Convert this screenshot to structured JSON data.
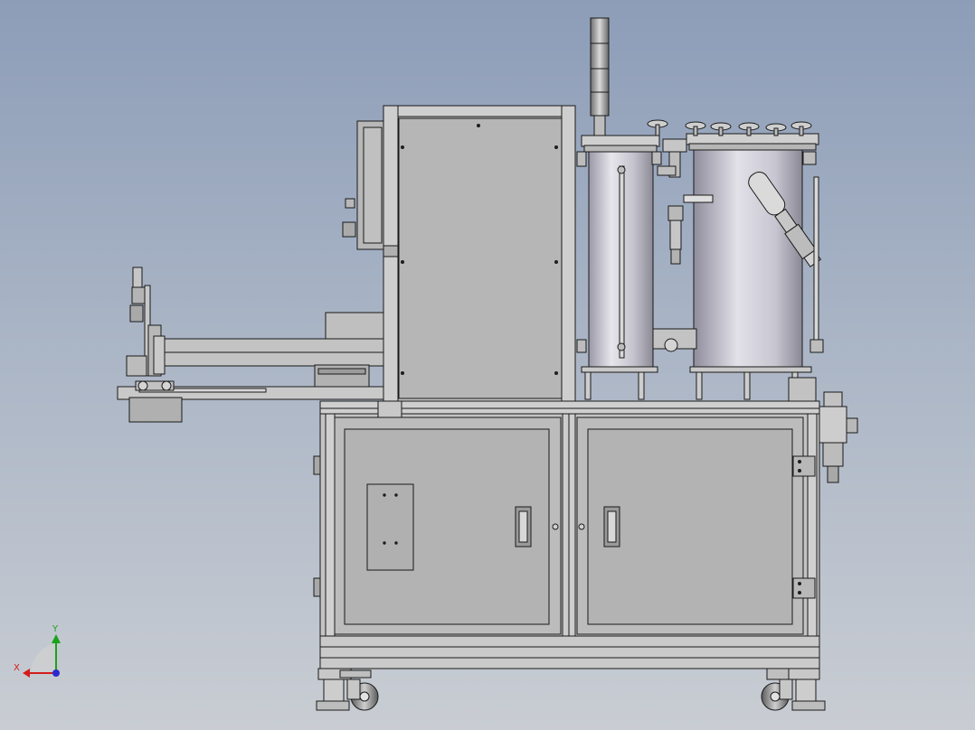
{
  "view": {
    "background_top": "#8d9db8",
    "background_bottom": "#c9cdd3",
    "line_color": "#1a1a1a",
    "body_fill": "#bdbdbd",
    "panel_fill": "#b3b3b3"
  },
  "triad": {
    "x_label": "X",
    "y_label": "Y",
    "x_color": "#d41c1c",
    "y_color": "#19a319",
    "z_color": "#2a2ad0"
  }
}
